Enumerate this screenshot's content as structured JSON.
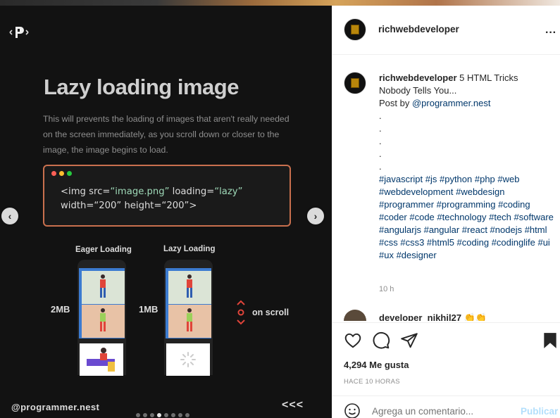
{
  "post": {
    "slide_title": "Lazy loading image",
    "slide_description": "This will prevents the loading of images that aren't really needed on the screen immediately, as you scroll down or closer to the image, the image begins to load.",
    "code_line1_tag": "<img src=",
    "code_line1_src": "“image.png”",
    "code_line1_attr": " loading=",
    "code_line1_lazy": "“lazy”",
    "code_line2_w": "width=",
    "code_line2_wv": "“200”",
    "code_line2_h": " height=",
    "code_line2_hv": "“200”",
    "code_line2_end": ">",
    "eager_label": "Eager Loading",
    "lazy_label": "Lazy Loading",
    "eager_size": "2MB",
    "lazy_size": "1MB",
    "scroll_label": "on scroll",
    "handle": "@programmer.nest",
    "chevrons": "<<<",
    "pager_count": 8,
    "pager_active": 3,
    "code_dot_colors": [
      "#ff5f56",
      "#ffbd2e",
      "#27c93f"
    ],
    "nav_prev_icon": "chevron-left-icon",
    "nav_next_icon": "chevron-right-icon"
  },
  "header": {
    "username": "richwebdeveloper",
    "more_icon": "more-horizontal-icon"
  },
  "caption": {
    "username": "richwebdeveloper",
    "text_line1": " 5 HTML Tricks",
    "text_line2": "Nobody Tells You...",
    "post_by": "Post by ",
    "post_by_link": "@programmer.nest",
    "dots": [
      ".",
      ".",
      ".",
      ".",
      "."
    ],
    "hashtags": "#javascript #js #python #php #web #webdevelopment #webdesign #programmer #programming #coding #coder #code #technology #tech #software #angularjs #angular #react #nodejs #html #css #css3 #html5 #coding #codinglife #ui #ux #designer",
    "time": "10 h"
  },
  "comment_peek": {
    "username": "developer_nikhil27 👏👏"
  },
  "actions": {
    "likes": "4,294 Me gusta",
    "ago": "HACE 10 HORAS",
    "comment_placeholder": "Agrega un comentario...",
    "publish": "Publicar"
  }
}
